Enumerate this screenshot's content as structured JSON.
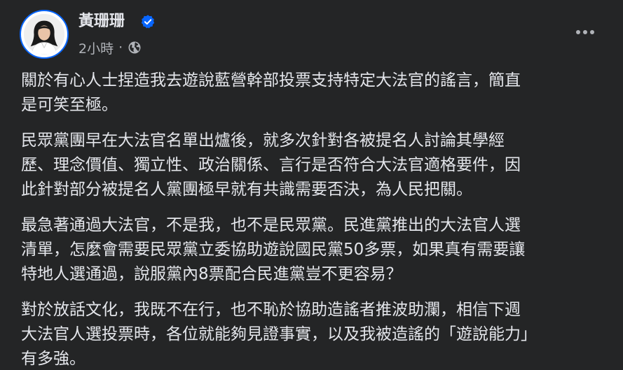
{
  "post": {
    "author": {
      "name": "黃珊珊",
      "verified": true
    },
    "timestamp": "2小時",
    "separator": "·",
    "privacy_icon": "globe-icon",
    "more_icon": "more-options-icon",
    "paragraphs": [
      {
        "lines": [
          "關於有心人士捏造我去遊說藍營幹部投票支持特定大法官的謠言，簡直",
          "是可笑至極。"
        ]
      },
      {
        "lines": [
          "民眾黨團早在大法官名單出爐後，就多次針對各被提名人討論其學經",
          "歷、理念價值、獨立性、政治關係、言行是否符合大法官適格要件，因",
          "此針對部分被提名人黨團極早就有共識需要否決，為人民把關。"
        ]
      },
      {
        "lines": [
          "最急著通過大法官，不是我，也不是民眾黨。民進黨推出的大法官人選",
          "清單，怎麼會需要民眾黨立委協助遊說國民黨50多票，如果真有需要讓",
          "特地人選通過，說服黨內8票配合民進黨豈不更容易？"
        ]
      },
      {
        "lines": [
          "對於放話文化，我既不在行，也不恥於協助造謠者推波助瀾，相信下週",
          "大法官人選投票時，各位就能夠見證事實，以及我被造謠的「遊說能力」",
          "有多強。"
        ]
      }
    ]
  },
  "colors": {
    "background": "#242526",
    "primary_text": "#e4e6eb",
    "secondary_text": "#b0b3b8",
    "verified_badge": "#0866ff"
  }
}
